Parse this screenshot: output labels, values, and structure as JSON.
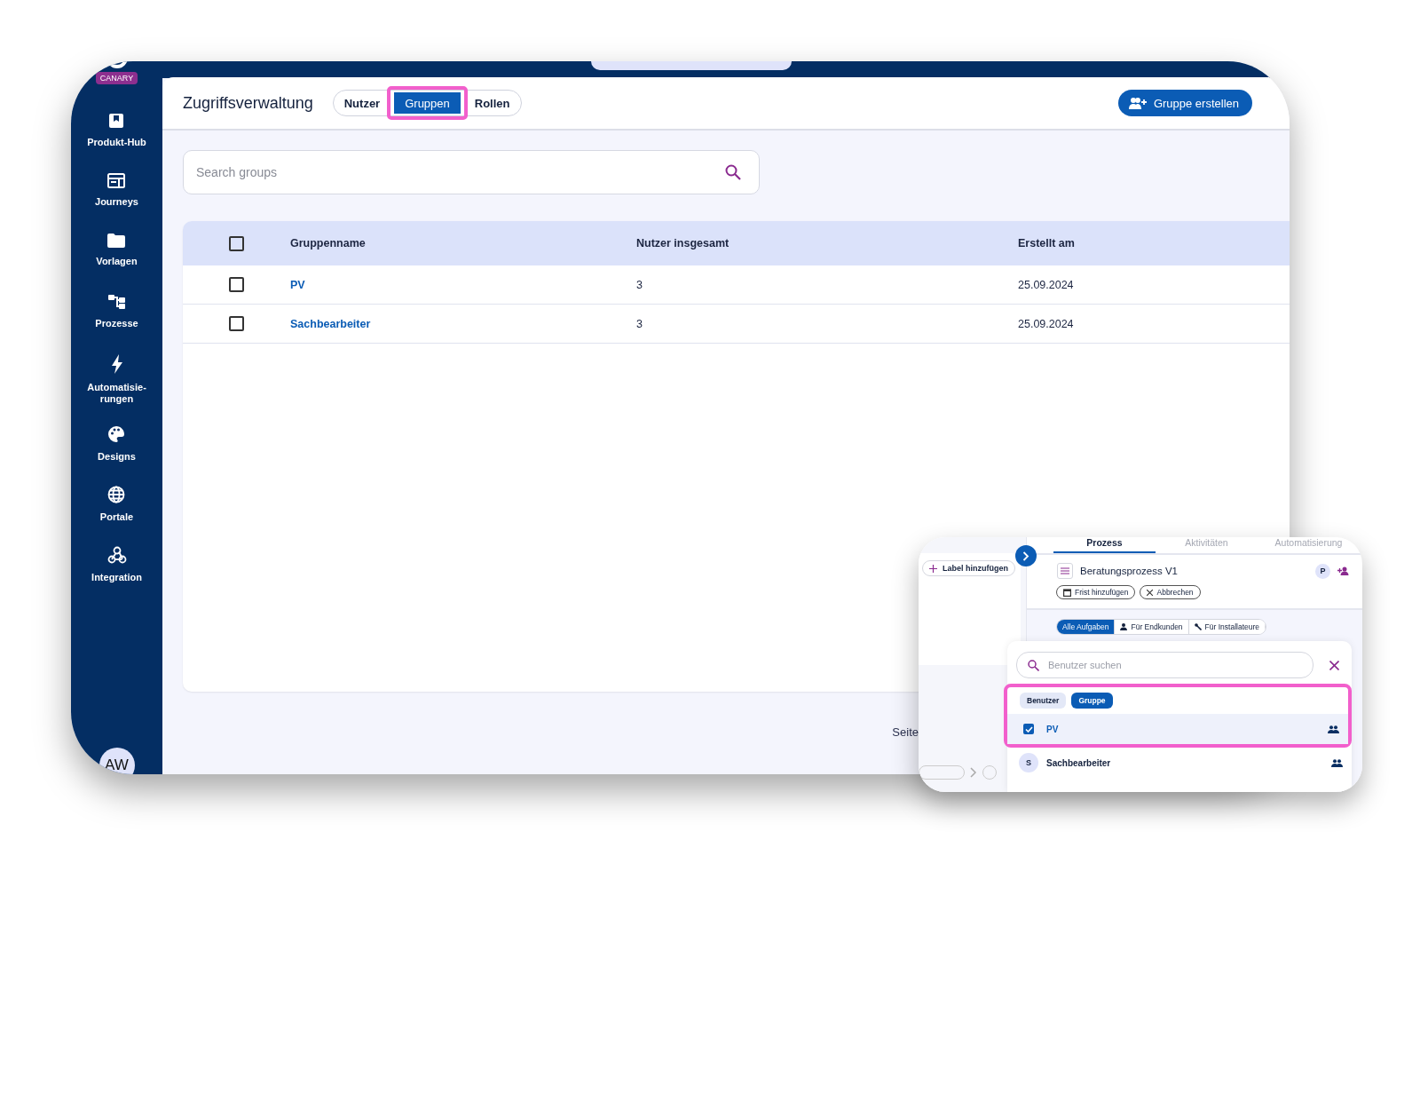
{
  "sidebar": {
    "badge": "CANARY",
    "items": [
      {
        "label": "Produkt-Hub"
      },
      {
        "label": "Journeys"
      },
      {
        "label": "Vorlagen"
      },
      {
        "label": "Prozesse"
      },
      {
        "label": "Automatisie-\nrungen"
      },
      {
        "label": "Designs"
      },
      {
        "label": "Portale"
      },
      {
        "label": "Integration"
      }
    ],
    "avatar": "AW"
  },
  "header": {
    "title": "Zugriffsverwaltung",
    "tabs": [
      {
        "label": "Nutzer",
        "selected": false,
        "highlighted": false
      },
      {
        "label": "Gruppen",
        "selected": true,
        "highlighted": true
      },
      {
        "label": "Rollen",
        "selected": false,
        "highlighted": false
      }
    ],
    "create_button": "Gruppe erstellen"
  },
  "search": {
    "placeholder": "Search groups"
  },
  "table": {
    "header_checked": false,
    "columns": [
      "Gruppenname",
      "Nutzer insgesamt",
      "Erstellt am"
    ],
    "rows": [
      {
        "checked": false,
        "cells": [
          "PV",
          "3",
          "25.09.2024"
        ]
      },
      {
        "checked": false,
        "cells": [
          "Sachbearbeiter",
          "3",
          "25.09.2024"
        ]
      }
    ]
  },
  "pagination": {
    "label": "Seite"
  },
  "inset": {
    "tabs": [
      {
        "label": "Prozess",
        "selected": true
      },
      {
        "label": "Aktivitäten",
        "selected": false
      },
      {
        "label": "Automatisierung",
        "selected": false
      }
    ],
    "label_button": "Label hinzufügen",
    "process_title": "Beratungsprozess V1",
    "assignee_initial": "P",
    "actions": [
      "Frist hinzufügen",
      "Abbrechen"
    ],
    "filters": [
      {
        "label": "Alle Aufgaben",
        "selected": true
      },
      {
        "label": "Für Endkunden",
        "selected": false
      },
      {
        "label": "Für Installateure",
        "selected": false
      }
    ],
    "picker": {
      "placeholder": "Benutzer suchen",
      "highlighted": true,
      "types": [
        {
          "label": "Benutzer",
          "selected": false
        },
        {
          "label": "Gruppe",
          "selected": true
        }
      ],
      "options": [
        {
          "name": "PV",
          "checked": true
        },
        {
          "name": "Sachbearbeiter",
          "checked": false,
          "initial": "S"
        }
      ]
    }
  }
}
